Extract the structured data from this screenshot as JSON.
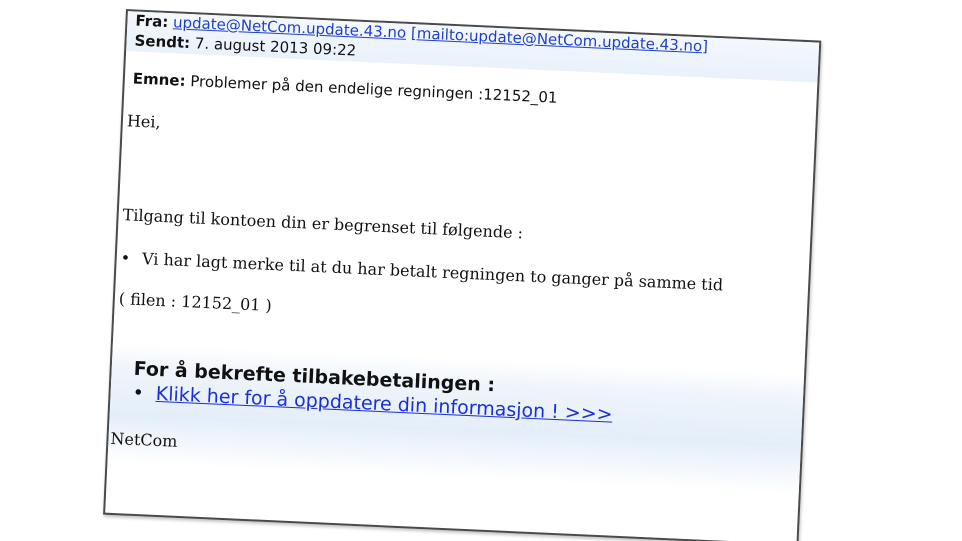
{
  "email": {
    "from_label": "Fra:",
    "from_address": "update@NetCom.update.43.no",
    "from_mailto": "[mailto:update@NetCom.update.43.no]",
    "sent_label": "Sendt:",
    "sent_value": "7. august 2013 09:22",
    "subject_label": "Emne:",
    "subject_value": "Problemer på den endelige regningen :12152_01",
    "greeting": "Hei,",
    "intro": "Tilgang til kontoen din er begrenset til følgende :",
    "bullet_marker": "•",
    "bullet_text": "Vi har lagt merke til at du har betalt regningen to ganger på samme tid",
    "file_ref": "( filen : 12152_01 )",
    "confirm_heading": "For å bekrefte tilbakebetalingen :",
    "confirm_link": "Klikk her for å oppdatere din informasjon ! >>>",
    "signature": "NetCom"
  },
  "colors": {
    "link": "#1f3fc9",
    "header_band": "#e9f1fb",
    "confirm_band": "#e4eef9",
    "border": "#4a4a4a"
  }
}
